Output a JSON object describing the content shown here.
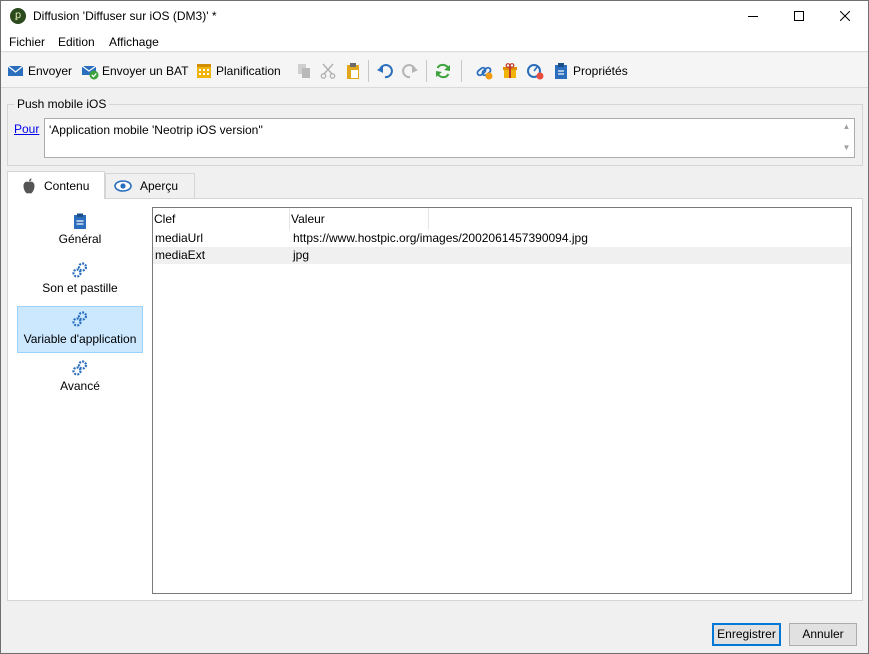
{
  "window": {
    "title": "Diffusion 'Diffuser sur iOS (DM3)' *"
  },
  "menu": [
    "Fichier",
    "Edition",
    "Affichage"
  ],
  "toolbar": {
    "send": "Envoyer",
    "send_proof": "Envoyer un BAT",
    "schedule": "Planification",
    "properties": "Propriétés"
  },
  "group": {
    "title": "Push mobile iOS",
    "for_link": "Pour",
    "for_value": "'Application mobile 'Neotrip iOS version''"
  },
  "tabs": [
    {
      "label": "Contenu",
      "active": true
    },
    {
      "label": "Aperçu",
      "active": false
    }
  ],
  "nav": [
    {
      "label": "Général",
      "icon": "clipboard-icon"
    },
    {
      "label": "Son et pastille",
      "icon": "gears-icon"
    },
    {
      "label": "Variable d'application",
      "icon": "gears-icon",
      "selected": true
    },
    {
      "label": "Avancé",
      "icon": "gears-icon"
    }
  ],
  "table": {
    "columns": [
      "Clef",
      "Valeur"
    ],
    "rows": [
      {
        "key": "mediaUrl",
        "value": "https://www.hostpic.org/images/2002061457390094.jpg"
      },
      {
        "key": "mediaExt",
        "value": "jpg"
      }
    ]
  },
  "buttons": {
    "save": "Enregistrer",
    "cancel": "Annuler"
  },
  "colors": {
    "selection": "#cce8ff",
    "link": "#0000ee",
    "accent": "#0078d7"
  }
}
